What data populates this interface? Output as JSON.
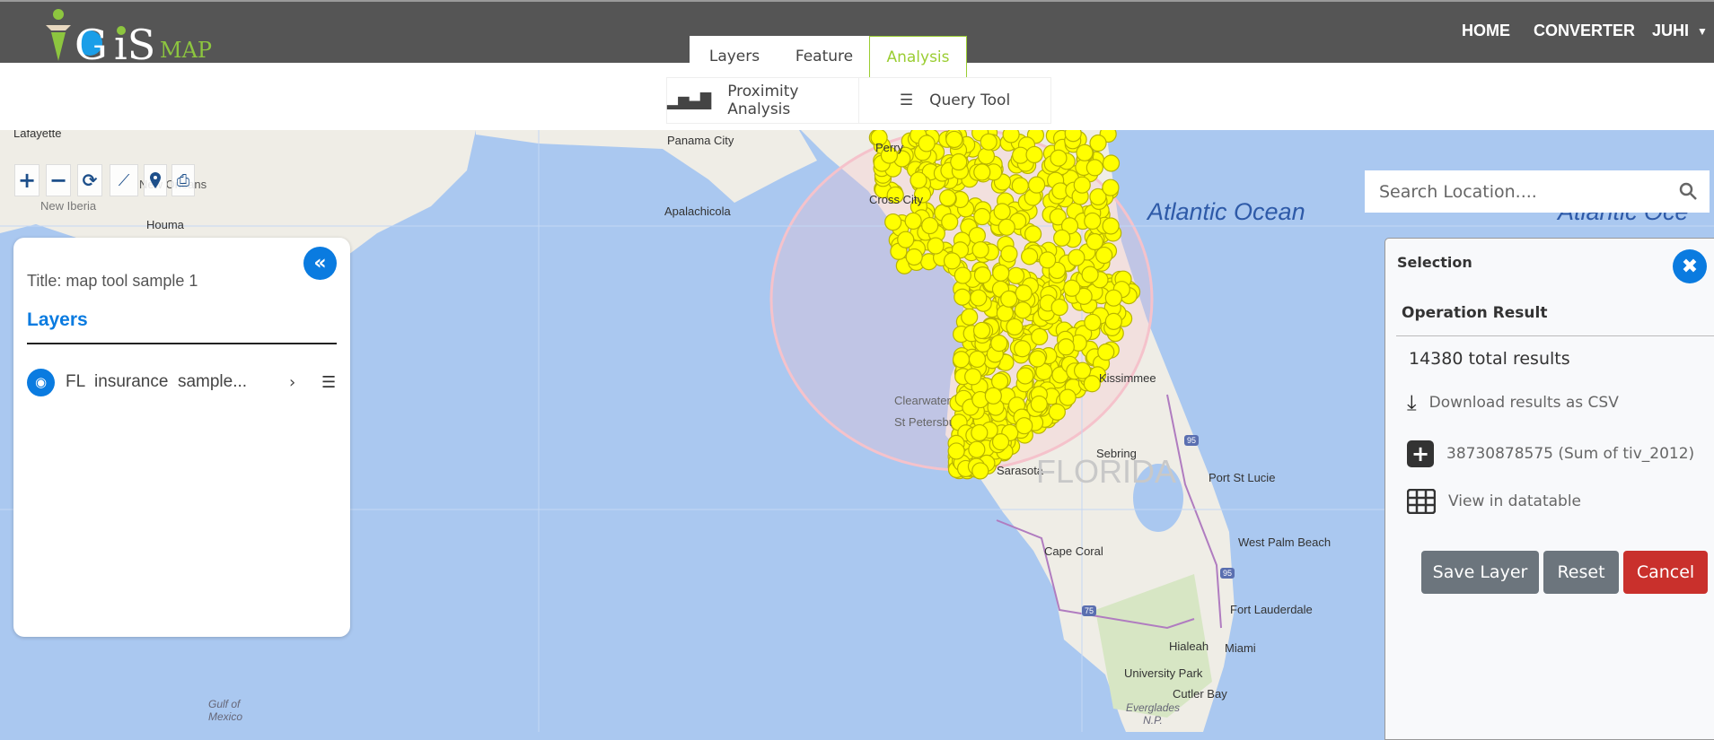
{
  "header": {
    "logo_text": "GiSMAP",
    "nav": [
      "HOME",
      "CONVERTER",
      "JUHI"
    ]
  },
  "tabs": [
    "Layers",
    "Feature",
    "Analysis"
  ],
  "tools": [
    "Proximity Analysis",
    "Query Tool"
  ],
  "search": {
    "placeholder": "Search Location...."
  },
  "left_panel": {
    "title": "Title: map tool sample 1",
    "heading": "Layers",
    "layer": "FL  insurance  sample..."
  },
  "right_panel": {
    "title": "Selection",
    "section": "Operation Result",
    "total": "14380 total results",
    "download": "Download results as CSV",
    "sum": "38730878575 (Sum of tiv_2012)",
    "datatable": "View in datatable",
    "buttons": [
      "Save Layer",
      "Reset",
      "Cancel"
    ]
  },
  "map": {
    "labels": [
      "Lafayette",
      "New Iberia",
      "New Orleans",
      "Houma",
      "Panama City",
      "Apalachicola",
      "Perry",
      "Cross City",
      "Clearwater",
      "St Petersburg",
      "Kissimmee",
      "Sebring",
      "Sarasota",
      "FLORIDA",
      "Port St Lucie",
      "West Palm Beach",
      "Cape Coral",
      "Fort Lauderdale",
      "Hialeah",
      "Miami",
      "University Park",
      "Cutler Bay",
      "Everglades N.P.",
      "Gulf of Mexico",
      "Atlantic Ocean",
      "Atlantic Oce"
    ],
    "route_shields": [
      "95",
      "95",
      "75"
    ]
  },
  "colors": {
    "accent": "#0a7be0",
    "header": "#555555",
    "tab_active": "#9acd32",
    "cancel": "#c9302c",
    "secondary": "#6c757d",
    "point": "#ffff00"
  }
}
